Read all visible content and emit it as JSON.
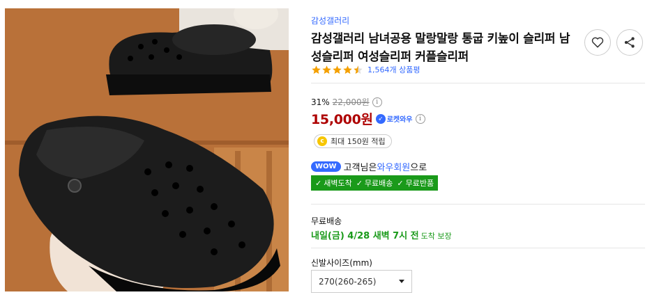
{
  "product": {
    "brand": "감성갤러리",
    "title": "감성갤러리 남녀공용 말랑말랑 통굽 키높이 슬리퍼 남성슬리퍼 여성슬리퍼 커플슬리퍼",
    "rating": 4.5,
    "review_count": "1,564개 상품평",
    "image_alt": "black platform clogs on a wooden shelf"
  },
  "actions": {
    "wishlist_icon": "heart-icon",
    "share_icon": "share-icon"
  },
  "price": {
    "discount_rate": "31%",
    "original_price": "22,000원",
    "sale_price": "15,000원",
    "rocket_label": "로켓와우",
    "info_glyph": "i"
  },
  "cash": {
    "coin_glyph": "c",
    "text": "최대 150원 적립"
  },
  "wow": {
    "badge": "WOW",
    "prefix": "고객님은 ",
    "link": "와우회원",
    "suffix": "으로",
    "benefits": [
      "새벽도착",
      "무료배송",
      "무료반품"
    ]
  },
  "shipping": {
    "label": "무료배송",
    "date_prefix": "내일(금) 4/28 새벽 7시 전",
    "date_suffix": "도착 보장"
  },
  "option": {
    "label": "신발사이즈(mm)",
    "selected": "270(260-265)"
  },
  "colors": {
    "accent": "#346aff",
    "price_red": "#ae0000",
    "green": "#1a9a1a",
    "star": "#f4a000"
  }
}
